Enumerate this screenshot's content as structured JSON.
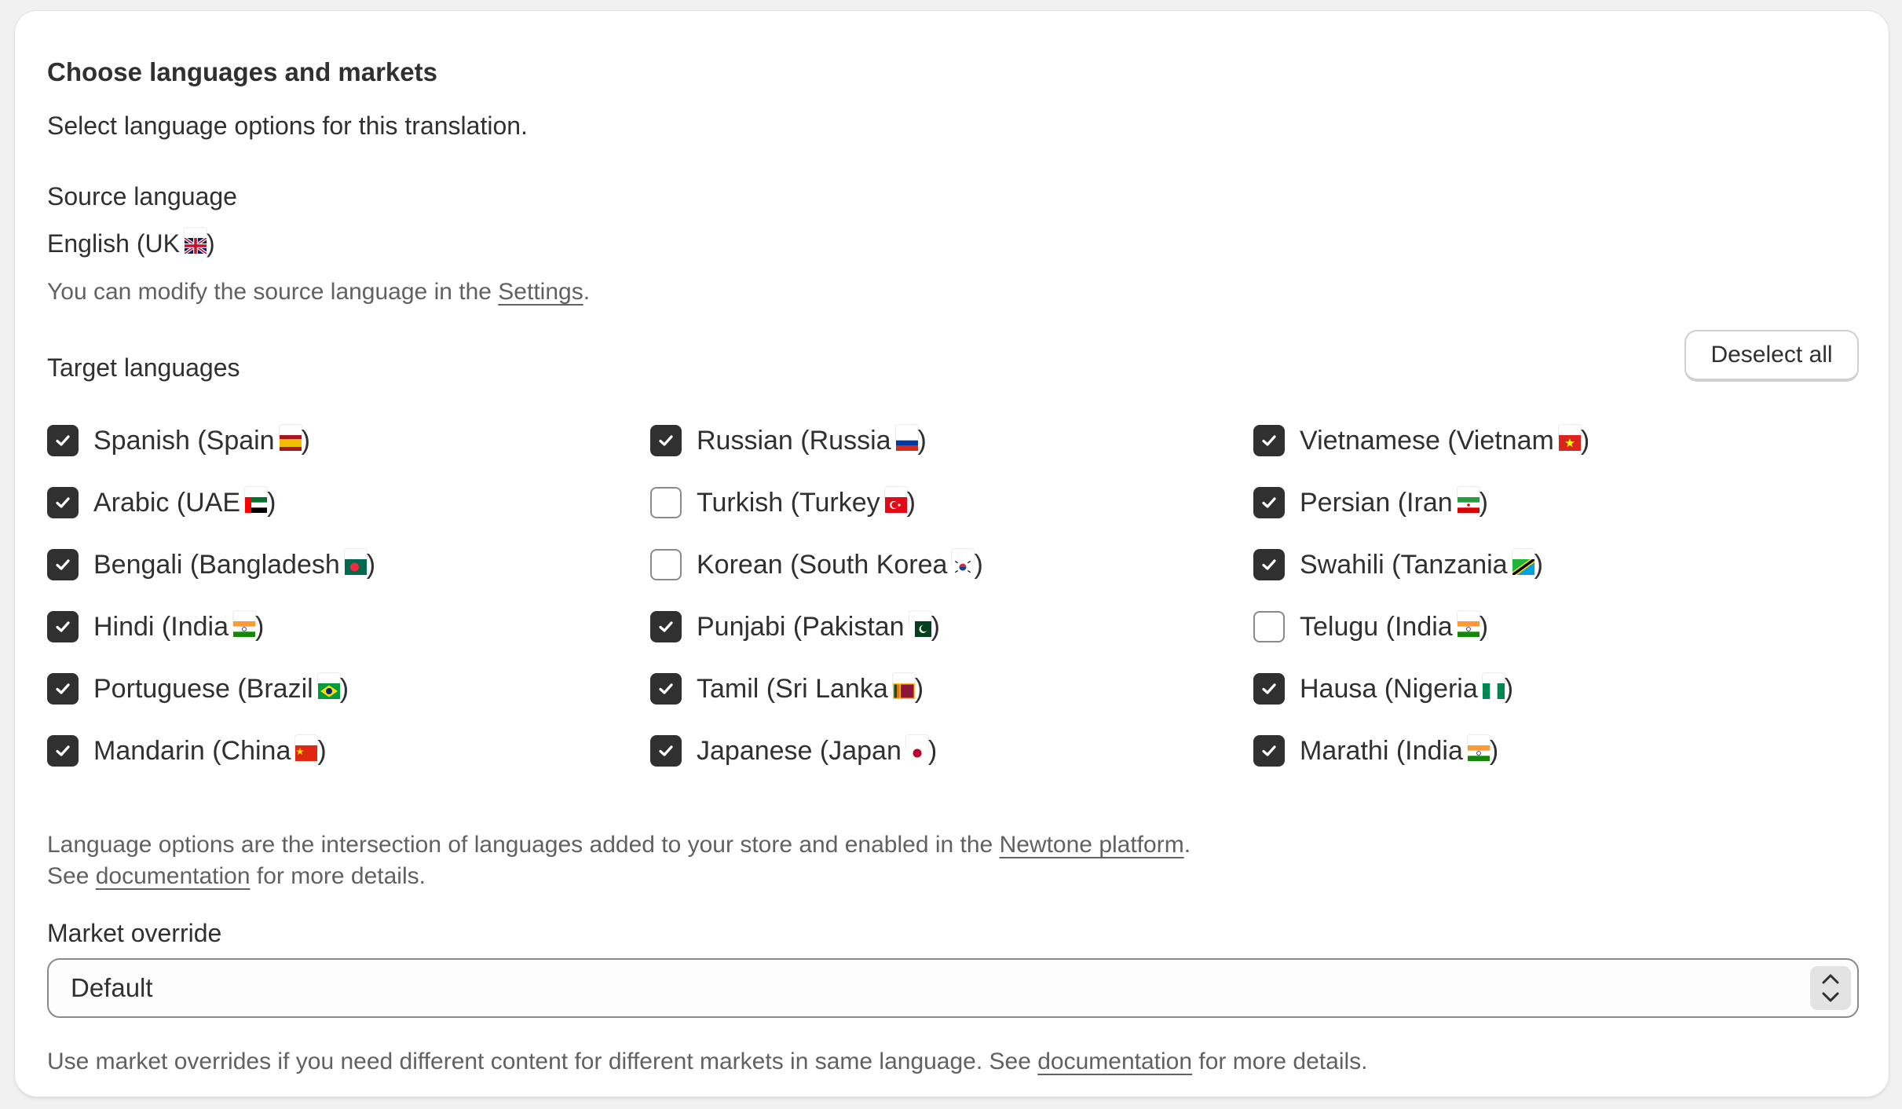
{
  "header": {
    "title": "Choose languages and markets",
    "subtitle": "Select language options for this translation."
  },
  "source": {
    "heading": "Source language",
    "value": "English (UK",
    "value_close": ")",
    "flag": "flag-uk",
    "note_prefix": "You can modify the source language in the ",
    "note_link": "Settings",
    "note_suffix": "."
  },
  "target": {
    "heading": "Target languages",
    "deselect_label": "Deselect all",
    "languages": [
      {
        "label": "Spanish (Spain",
        "flag": "flag-spain",
        "checked": true
      },
      {
        "label": "Arabic (UAE",
        "flag": "flag-uae",
        "checked": true
      },
      {
        "label": "Bengali (Bangladesh",
        "flag": "flag-bangladesh",
        "checked": true
      },
      {
        "label": "Hindi (India",
        "flag": "flag-india",
        "checked": true
      },
      {
        "label": "Portuguese (Brazil",
        "flag": "flag-brazil",
        "checked": true
      },
      {
        "label": "Mandarin (China",
        "flag": "flag-china",
        "checked": true
      },
      {
        "label": "Russian (Russia",
        "flag": "flag-russia",
        "checked": true
      },
      {
        "label": "Turkish (Turkey",
        "flag": "flag-turkey",
        "checked": false
      },
      {
        "label": "Korean (South Korea",
        "flag": "flag-south-korea",
        "checked": false
      },
      {
        "label": "Punjabi (Pakistan",
        "flag": "flag-pakistan",
        "checked": true
      },
      {
        "label": "Tamil (Sri Lanka",
        "flag": "flag-sri-lanka",
        "checked": true
      },
      {
        "label": "Japanese (Japan",
        "flag": "flag-japan",
        "checked": true
      },
      {
        "label": "Vietnamese (Vietnam",
        "flag": "flag-vietnam",
        "checked": true
      },
      {
        "label": "Persian (Iran",
        "flag": "flag-iran",
        "checked": true
      },
      {
        "label": "Swahili (Tanzania",
        "flag": "flag-tanzania",
        "checked": true
      },
      {
        "label": "Telugu (India",
        "flag": "flag-india",
        "checked": false
      },
      {
        "label": "Hausa (Nigeria",
        "flag": "flag-nigeria",
        "checked": true
      },
      {
        "label": "Marathi (India",
        "flag": "flag-india",
        "checked": true
      }
    ],
    "close_paren": ")"
  },
  "info": {
    "line1_prefix": "Language options are the intersection of languages added to your store and enabled in the ",
    "line1_link": "Newtone platform",
    "line1_suffix": ".",
    "line2_prefix": "See ",
    "line2_link": "documentation",
    "line2_suffix": " for more details."
  },
  "market": {
    "heading": "Market override",
    "selected": "Default",
    "help_prefix": "Use market overrides if you need different content for different markets in same language. See ",
    "help_link": "documentation",
    "help_suffix": " for more details."
  },
  "colors": {
    "checked_fill": "#303030",
    "unchecked_border": "#8a8a8a",
    "muted_text": "#616161"
  }
}
